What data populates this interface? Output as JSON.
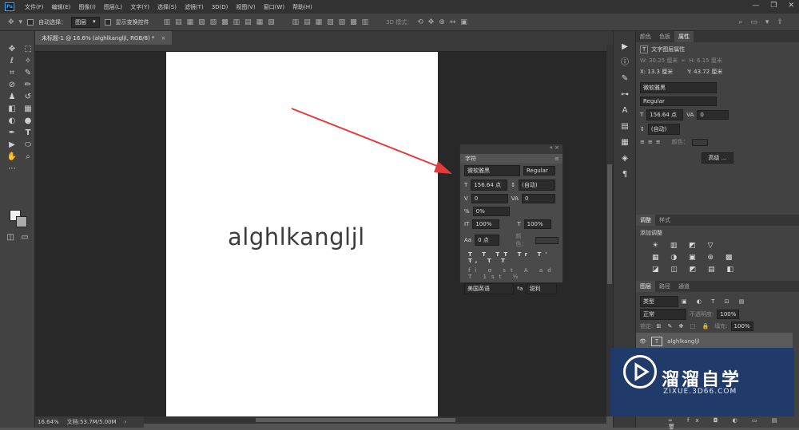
{
  "menu": [
    "文件(F)",
    "编辑(E)",
    "图像(I)",
    "图层(L)",
    "文字(Y)",
    "选择(S)",
    "滤镜(T)",
    "3D(D)",
    "视图(V)",
    "窗口(W)",
    "帮助(H)"
  ],
  "options": {
    "auto_select": "自动选择：",
    "target": "图层",
    "show_transform": "显示变换控件",
    "mode3d": "3D 模式："
  },
  "doc_tab": {
    "title": "未标题-1 @ 16.6% (alghlkangljl, RGB/8) *"
  },
  "canvas_text": "alghlkangljl",
  "status": {
    "zoom": "16.64%",
    "doc": "文档:53.7M/5.00M"
  },
  "props_panel": {
    "tabs": [
      "颜色",
      "色板",
      "属性"
    ],
    "section": "文字图层属性",
    "w": "W: 30.25 厘米",
    "h": "H: 6.15 厘米",
    "x": "X: 13.3 厘米",
    "y": "Y: 43.72 厘米",
    "font": "微软雅黑",
    "style": "Regular",
    "size": "156.64 点",
    "tracking": "0",
    "leading": "(自动)",
    "color_label": "颜色：",
    "advanced": "高级 ..."
  },
  "adjust_panel": {
    "tabs": [
      "调整",
      "样式"
    ],
    "add": "添加调整"
  },
  "layers_panel": {
    "tabs": [
      "图层",
      "路径",
      "通道"
    ],
    "filter": "类型",
    "blend": "正常",
    "opacity_label": "不透明度:",
    "opacity": "100%",
    "lock_label": "锁定:",
    "fill_label": "填充:",
    "fill": "100%",
    "layer_name": "alghlkangljl"
  },
  "char_panel": {
    "title": "字符",
    "font": "微软雅黑",
    "style": "Regular",
    "size": "156.64 点",
    "leading": "(自动)",
    "kerning": "0",
    "tracking": "0",
    "scale_pct": "0%",
    "vscale": "100%",
    "hscale": "100%",
    "baseline": "0 点",
    "color_label": "颜色：",
    "language": "美国英语",
    "aa_label": "ªa",
    "aa": "锐利"
  },
  "watermark": {
    "title": "溜溜自学",
    "subtitle": "ZIXUE.3D66.COM"
  },
  "colors": {
    "accent": "#31a8ff",
    "arrow": "#e23b3b",
    "badge": "#1f3a6c"
  }
}
